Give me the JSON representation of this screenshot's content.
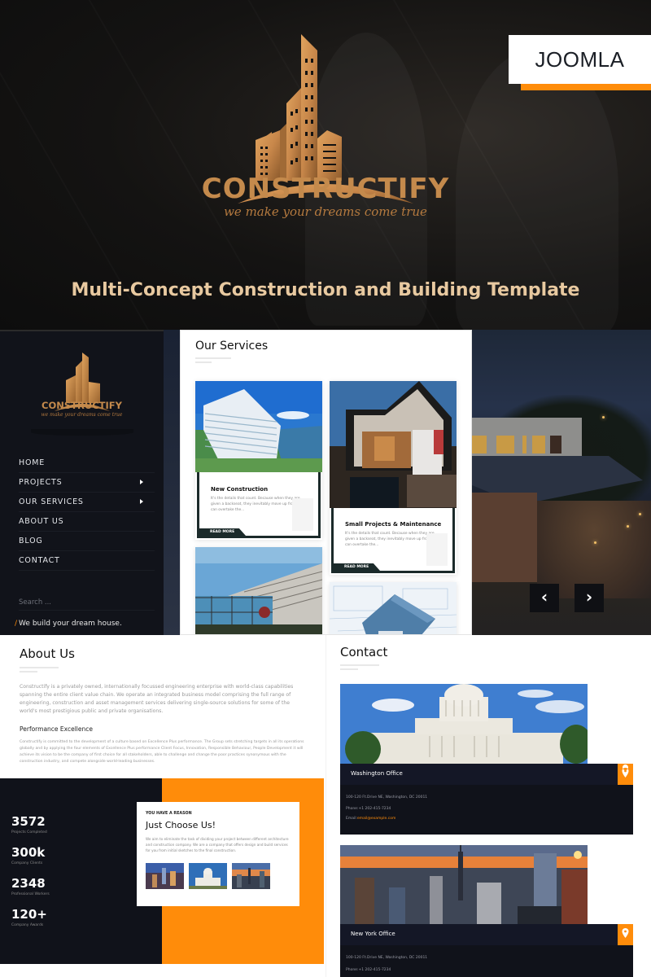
{
  "hero": {
    "brand": "CONSTRUCTIFY",
    "tagline": "we make your dreams come true",
    "subtitle": "Multi-Concept Construction and Building Template",
    "badge": "JOOMLA",
    "brand_color": "#c48a4c",
    "accent_color": "#ff8c0a"
  },
  "sidebar": {
    "brand": "CONSTRUCTIFY",
    "tagline": "we make your dreams come true",
    "nav": [
      {
        "label": "HOME",
        "has_submenu": false
      },
      {
        "label": "PROJECTS",
        "has_submenu": true
      },
      {
        "label": "OUR SERVICES",
        "has_submenu": true
      },
      {
        "label": "ABOUT US",
        "has_submenu": false
      },
      {
        "label": "BLOG",
        "has_submenu": false
      },
      {
        "label": "CONTACT",
        "has_submenu": false
      }
    ],
    "search_placeholder": "Search ...",
    "slogan_mark": "/",
    "slogan": "We build your dream house."
  },
  "services": {
    "title": "Our Services",
    "cards": [
      {
        "title": "New Construction",
        "text": "It's the details that count. Because when they are given a backseat, they inevitably move up front and can overtake the...",
        "button": "READ MORE"
      },
      {
        "title": "Small Projects & Maintenance",
        "text": "It's the details that count. Because when they are given a backseat, they inevitably move up front and can overtake the...",
        "button": "READ MORE"
      }
    ]
  },
  "slider": {
    "prev": "‹",
    "next": "›"
  },
  "about": {
    "title": "About Us",
    "text": "Constructify is a privately owned, internationally focussed engineering enterprise with world-class capabilities spanning the entire client value chain. We operate an integrated business model comprising the full range of engineering, construction and asset management services delivering single-source solutions for some of the world's most prestigious public and private organisations.",
    "subtitle": "Performance Excellence",
    "text2": "Constructify is committed to the development of a culture based on Excellence Plus performance. The Group sets stretching targets in all its operations globally and by applying the four elements of Excellence Plus performance Client Focus, Innovation, Responsible Behaviour, People Development it will achieve its vision to be the company of first choice for all stakeholders, able to challenge and change the poor practices synonymous with the construction industry, and compete alongside world-leading businesses."
  },
  "stats": [
    {
      "value": "3572",
      "label": "Projects Completed"
    },
    {
      "value": "300k",
      "label": "Company Clients"
    },
    {
      "value": "2348",
      "label": "Professional Workers"
    },
    {
      "value": "120+",
      "label": "Company Awards"
    }
  ],
  "choose": {
    "kicker": "YOU HAVE A REASON",
    "title": "Just Choose Us!",
    "text": "We aim to eliminate the task of dividing your project between different architecture and construction company. We are a company that offers design and build services for you from initial sketches to the final construction."
  },
  "contact": {
    "title": "Contact",
    "offices": [
      {
        "name": "Washington Office",
        "address": "100-120 Ft.Drive NE, Washington, DC 20011",
        "phone": "Phone:+1 202-415-7234",
        "email_label": "Email:",
        "email": "email@example.com"
      },
      {
        "name": "New York Office",
        "address": "100-120 Ft.Drive NE, Washington, DC 20011",
        "phone": "Phone:+1 202-415-7234"
      }
    ]
  }
}
